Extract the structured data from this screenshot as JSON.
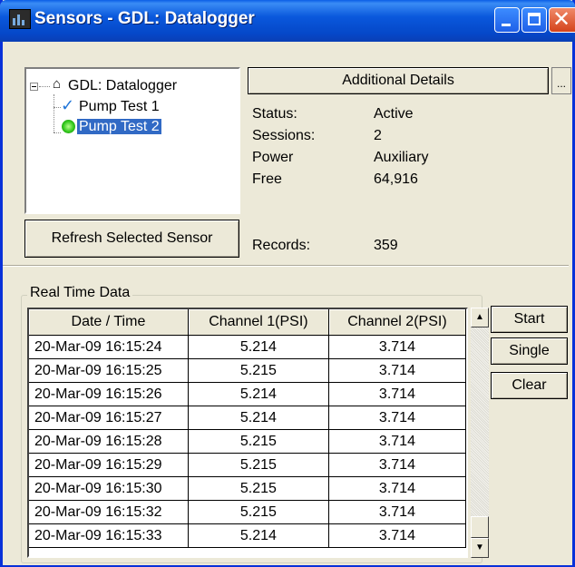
{
  "window": {
    "title": "Sensors - GDL: Datalogger"
  },
  "tree": {
    "root": "GDL: Datalogger",
    "items": [
      {
        "label": "Pump Test 1",
        "icon": "checkmark-icon"
      },
      {
        "label": "Pump Test 2",
        "icon": "green-sensor-icon",
        "selected": true
      }
    ]
  },
  "details": {
    "header": "Additional Details",
    "ellipsis": "...",
    "fields": [
      {
        "label": "Status:",
        "value": "Active"
      },
      {
        "label": "Sessions:",
        "value": "2"
      },
      {
        "label": "Power",
        "value": "Auxiliary"
      },
      {
        "label": "Free",
        "value": "64,916"
      }
    ],
    "records_label": "Records:",
    "records_value": "359"
  },
  "refresh_label": "Refresh Selected Sensor",
  "realtime": {
    "title": "Real Time Data",
    "columns": [
      "Date / Time",
      "Channel 1(PSI)",
      "Channel 2(PSI)"
    ],
    "rows": [
      [
        "20-Mar-09 16:15:24",
        "5.214",
        "3.714"
      ],
      [
        "20-Mar-09 16:15:25",
        "5.215",
        "3.714"
      ],
      [
        "20-Mar-09 16:15:26",
        "5.214",
        "3.714"
      ],
      [
        "20-Mar-09 16:15:27",
        "5.214",
        "3.714"
      ],
      [
        "20-Mar-09 16:15:28",
        "5.215",
        "3.714"
      ],
      [
        "20-Mar-09 16:15:29",
        "5.215",
        "3.714"
      ],
      [
        "20-Mar-09 16:15:30",
        "5.215",
        "3.714"
      ],
      [
        "20-Mar-09 16:15:32",
        "5.215",
        "3.714"
      ],
      [
        "20-Mar-09 16:15:33",
        "5.214",
        "3.714"
      ]
    ]
  },
  "buttons": {
    "start": "Start",
    "single": "Single",
    "clear": "Clear"
  },
  "colors": {
    "titlebar": "#0a58dc",
    "selection": "#316ac5",
    "window_bg": "#ece9d8"
  }
}
